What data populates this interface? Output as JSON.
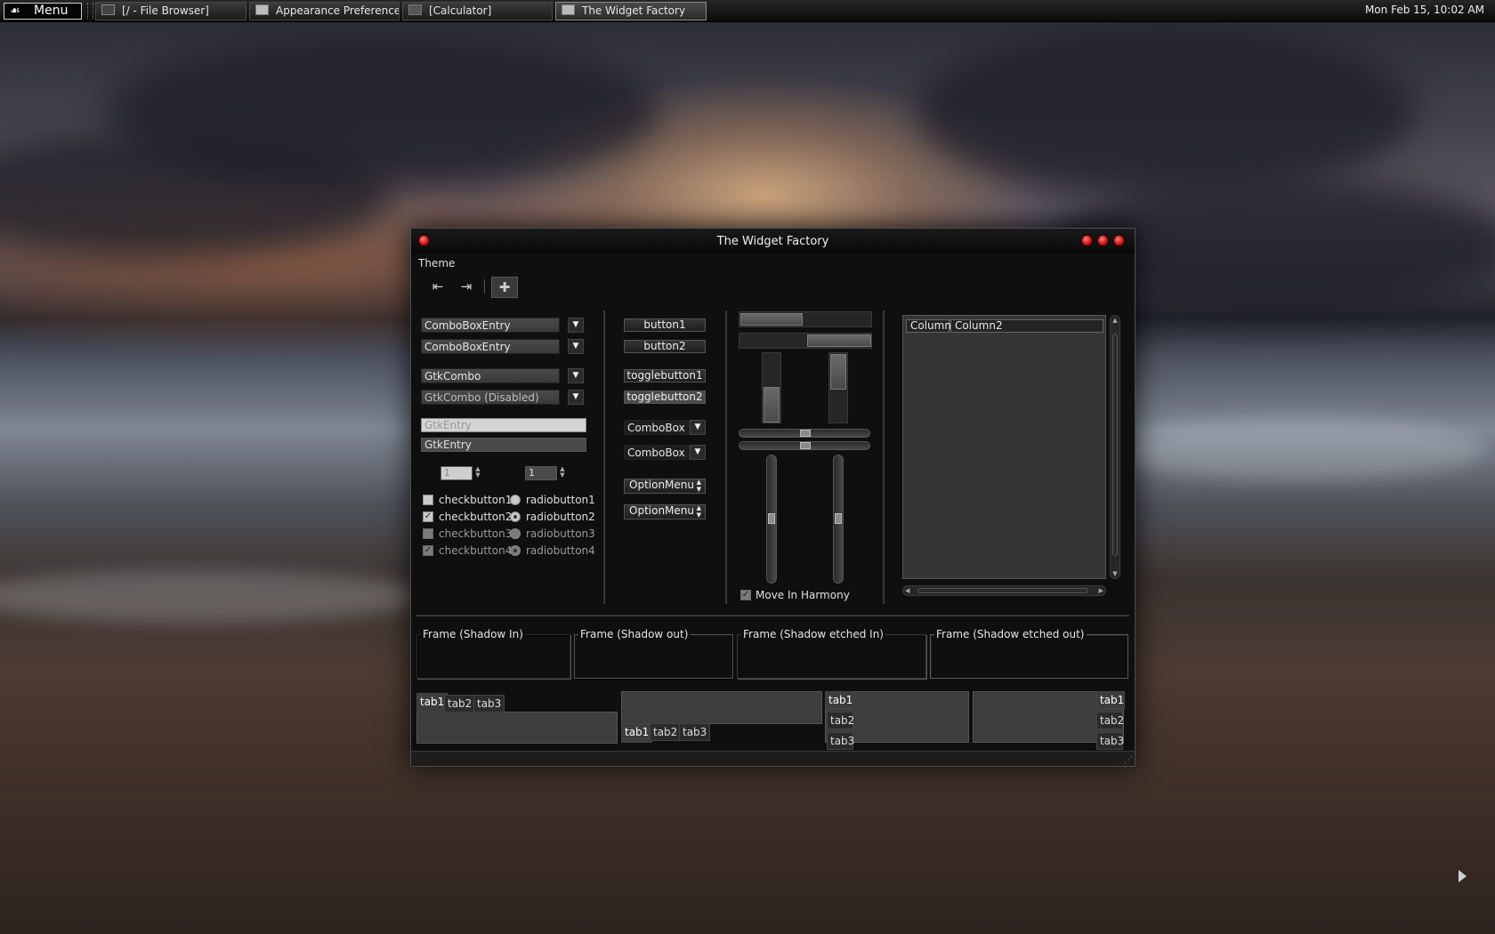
{
  "panel": {
    "menu_label": "Menu",
    "tasks": [
      {
        "label": "[/ - File Browser]"
      },
      {
        "label": "Appearance Preferences"
      },
      {
        "label": "[Calculator]"
      },
      {
        "label": "The Widget Factory"
      }
    ],
    "clock": "Mon Feb 15, 10:02 AM"
  },
  "window": {
    "title": "The Widget Factory",
    "menu": "Theme",
    "col1": {
      "combo_entry_1": "ComboBoxEntry",
      "combo_entry_2": "ComboBoxEntry",
      "gtk_combo": "GtkCombo",
      "gtk_combo_disabled": "GtkCombo (Disabled)",
      "entry_1": "GtkEntry",
      "entry_2": "GtkEntry",
      "spin_1": "1",
      "spin_2": "1",
      "checks": [
        "checkbutton1",
        "checkbutton2",
        "checkbutton3",
        "checkbutton4"
      ],
      "radios": [
        "radiobutton1",
        "radiobutton2",
        "radiobutton3",
        "radiobutton4"
      ]
    },
    "col2": {
      "button1": "button1",
      "button2": "button2",
      "toggle1": "togglebutton1",
      "toggle2": "togglebutton2",
      "combo1": "ComboBox",
      "combo2": "ComboBox",
      "option1": "OptionMenu",
      "option2": "OptionMenu"
    },
    "col3": {
      "move_in_harmony": "Move In Harmony"
    },
    "tree": {
      "column1": "Column1",
      "column2": "Column2"
    },
    "frames": [
      "Frame (Shadow In)",
      "Frame (Shadow out)",
      "Frame (Shadow etched In)",
      "Frame (Shadow etched out)"
    ],
    "tabs": [
      "tab1",
      "tab2",
      "tab3"
    ]
  }
}
